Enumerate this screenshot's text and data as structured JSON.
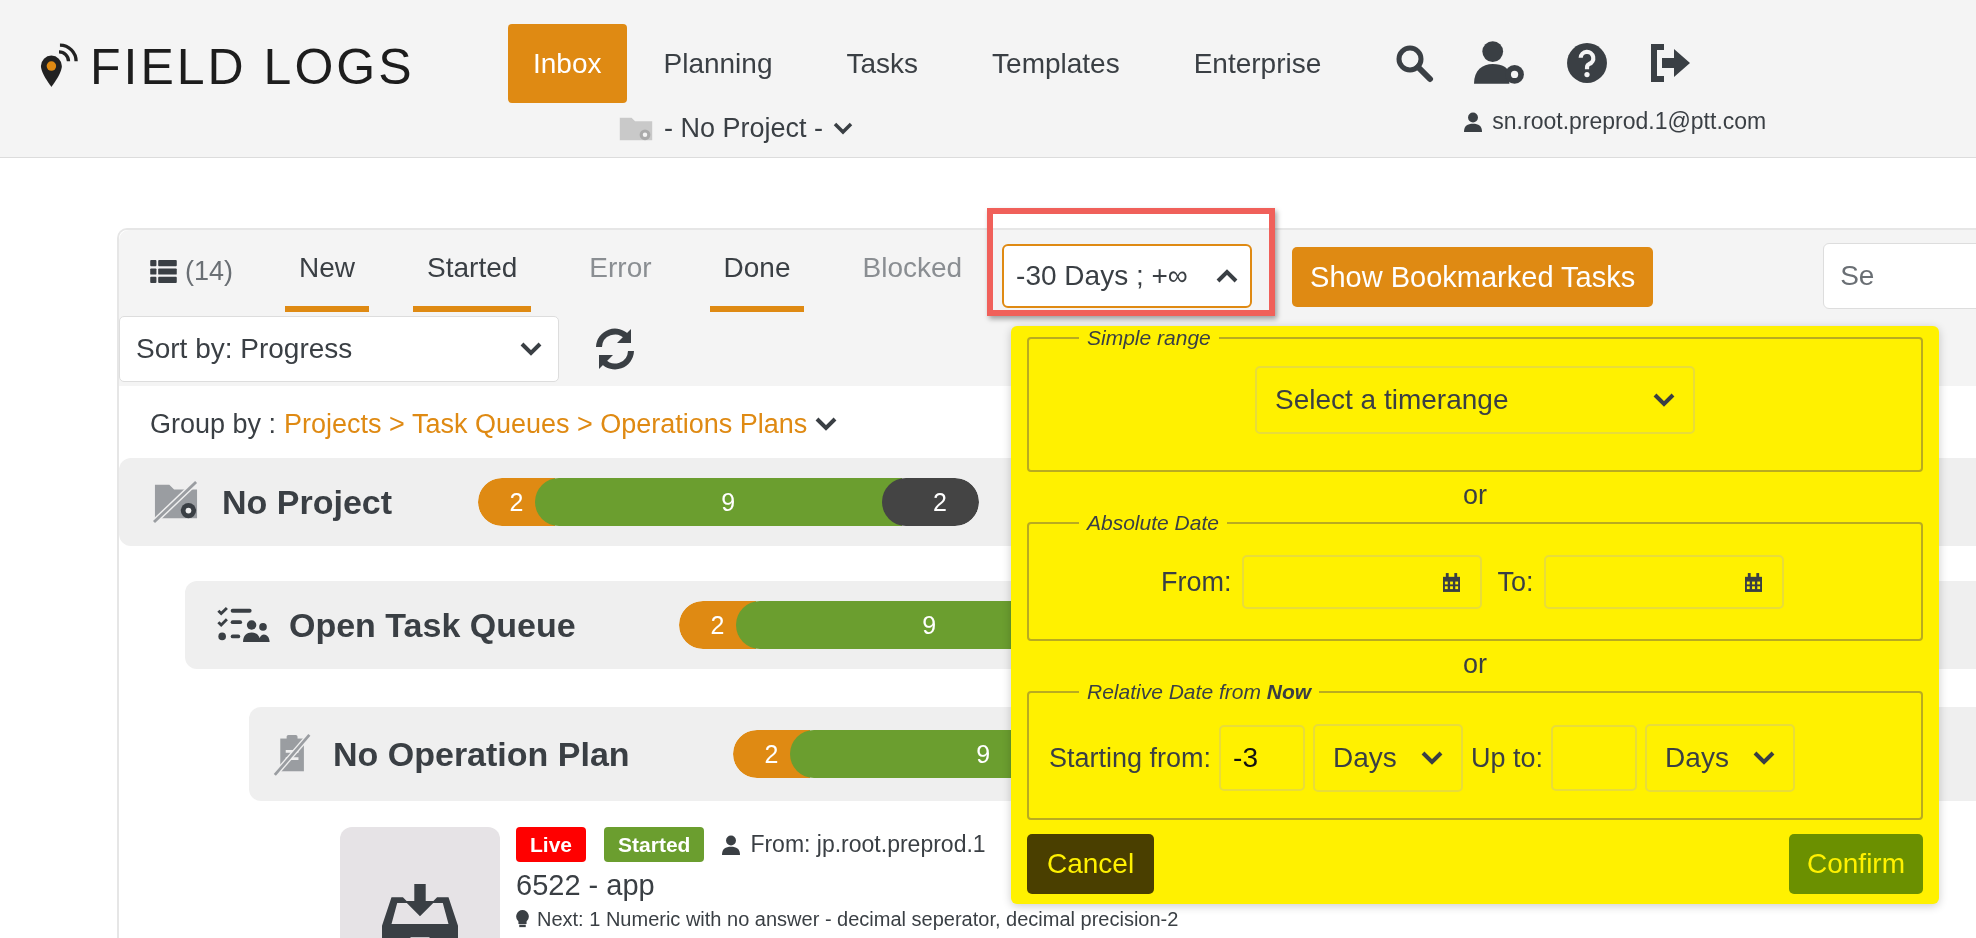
{
  "logo": {
    "text": "FIELD LOGS"
  },
  "nav": [
    {
      "label": "Inbox",
      "selected": true
    },
    {
      "label": "Planning",
      "selected": false
    },
    {
      "label": "Tasks",
      "selected": false
    },
    {
      "label": "Templates",
      "selected": false
    },
    {
      "label": "Enterprise",
      "selected": false
    }
  ],
  "project_selector": {
    "label": "- No Project -"
  },
  "user": {
    "email": "sn.root.preprod.1@ptt.com"
  },
  "toolbar": {
    "count": "(14)",
    "filters": [
      {
        "label": "New",
        "on": true
      },
      {
        "label": "Started",
        "on": true
      },
      {
        "label": "Error",
        "on": false
      },
      {
        "label": "Done",
        "on": true
      },
      {
        "label": "Blocked",
        "on": false
      }
    ],
    "date_range": {
      "label": "-30 Days ; +∞",
      "expanded": true,
      "highlighted": true
    },
    "bookmark_button": "Show Bookmarked Tasks",
    "search": {
      "placeholder": "Se"
    }
  },
  "sort": {
    "value": "Sort by: Progress"
  },
  "group_by": {
    "label": "Group by :",
    "value": "Projects > Task Queues > Operations Plans"
  },
  "groups": [
    {
      "kind": "project",
      "title": "No Project",
      "segments": [
        {
          "count": "2",
          "color": "#df8a13"
        },
        {
          "count": "9",
          "color": "#6b9e2f"
        },
        {
          "count": "2",
          "color": "#444444"
        }
      ],
      "children": [
        {
          "kind": "queue",
          "title": "Open Task Queue",
          "segments": [
            {
              "count": "2",
              "color": "#df8a13"
            },
            {
              "count": "9",
              "color": "#6b9e2f"
            }
          ],
          "children": [
            {
              "kind": "plan",
              "title": "No Operation Plan",
              "segments": [
                {
                  "count": "2",
                  "color": "#df8a13"
                },
                {
                  "count": "9",
                  "color": "#6b9e2f"
                }
              ],
              "tasks": [
                {
                  "badges": [
                    {
                      "label": "Live",
                      "color": "#ff0000"
                    },
                    {
                      "label": "Started",
                      "color": "#6b9e2f"
                    }
                  ],
                  "from": "From: jp.root.preprod.1",
                  "title": "6522 - app",
                  "next": "Next: 1 Numeric with no answer - decimal seperator, decimal precision-2"
                }
              ]
            }
          ]
        }
      ]
    }
  ],
  "date_popup": {
    "highlighted": true,
    "simple_range": {
      "legend": "Simple range",
      "select": "Select a timerange"
    },
    "separators": [
      "or",
      "or"
    ],
    "absolute": {
      "legend": "Absolute Date",
      "from_label": "From:",
      "to_label": "To:"
    },
    "relative": {
      "legend": "Relative Date from **Now**",
      "start_label": "Starting from:",
      "start_value": "-3",
      "start_unit": "Days",
      "end_label": "Up to:",
      "end_unit": "Days"
    },
    "cancel": "Cancel",
    "confirm": "Confirm"
  }
}
